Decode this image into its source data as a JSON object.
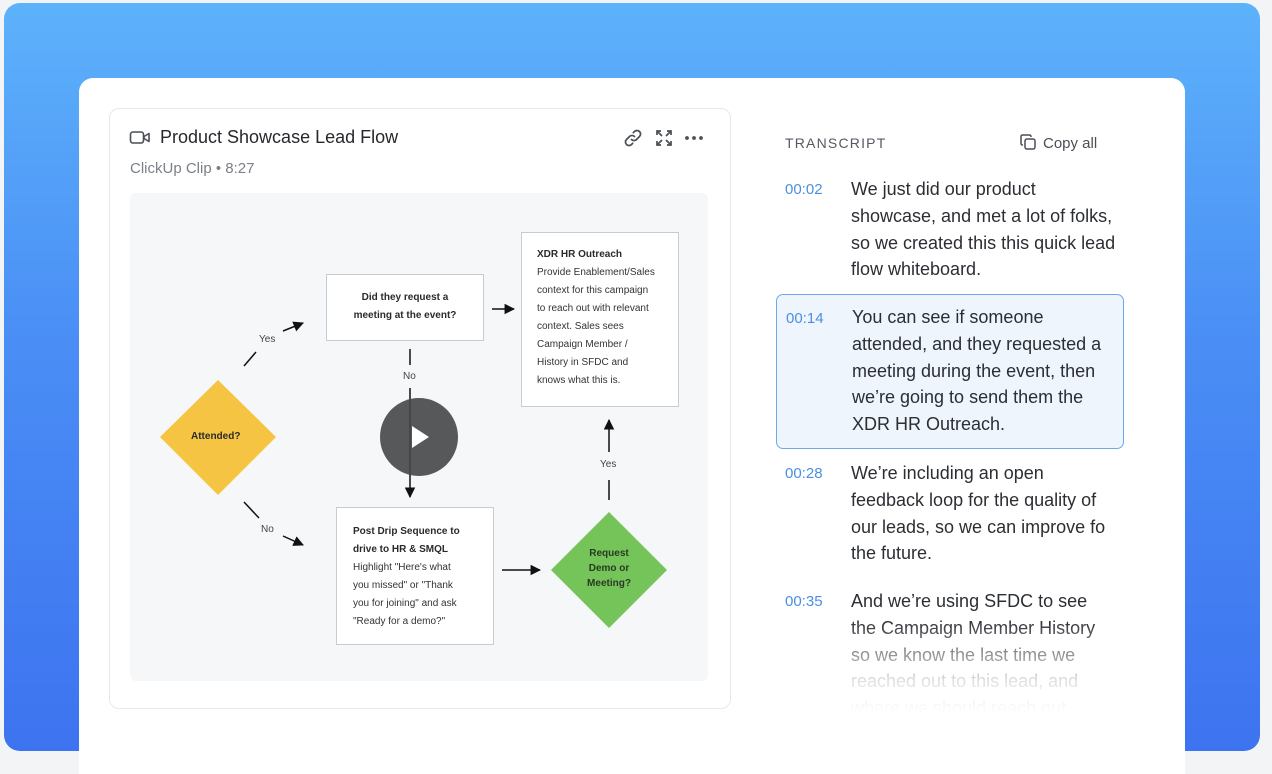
{
  "clip": {
    "title": "Product Showcase Lead Flow",
    "subtitle": "ClickUp Clip • 8:27",
    "icons": [
      "video-icon",
      "link-icon",
      "expand-icon",
      "more-icon"
    ]
  },
  "flowchart": {
    "attended": "Attended?",
    "yes_upper": "Yes",
    "no_lower": "No",
    "request_box": [
      "Did they request a",
      "meeting at the event?"
    ],
    "no_middle": "No",
    "outreach_title": "XDR HR Outreach",
    "outreach_body": [
      "Provide Enablement/Sales",
      "context for this campaign",
      "to reach out with relevant",
      "context. Sales sees",
      "Campaign Member /",
      "History in SFDC and",
      "knows what this is."
    ],
    "drip_title": [
      "Post Drip Sequence to",
      "drive to HR & SMQL"
    ],
    "drip_body": [
      "Highlight \"Here's what",
      "you missed\" or \"Thank",
      "you for joining\" and ask",
      "\"Ready for a demo?\""
    ],
    "demo": [
      "Request",
      "Demo or",
      "Meeting?"
    ],
    "yes_right": "Yes",
    "colors": {
      "attended": "#f5c443",
      "demo": "#74c45a"
    }
  },
  "transcript": {
    "label": "TRANSCRIPT",
    "copy_all": "Copy all",
    "accent": "#4a8fe0",
    "segments": [
      {
        "time": "00:02",
        "text": "We just did our product showcase, and met a lot of folks, so we created this this quick lead flow whiteboard."
      },
      {
        "time": "00:14",
        "text": "You can see if someone attended, and they requested a meeting during the event, then we’re going to send them the XDR HR Outreach."
      },
      {
        "time": "00:28",
        "text": "We’re including an open feedback loop for the quality of our leads, so we can improve fo the future."
      },
      {
        "time": "00:35",
        "text": "And we’re using SFDC to see the Campaign Member History so we know the last time we reached out to this lead, and where we should reach out"
      }
    ]
  }
}
